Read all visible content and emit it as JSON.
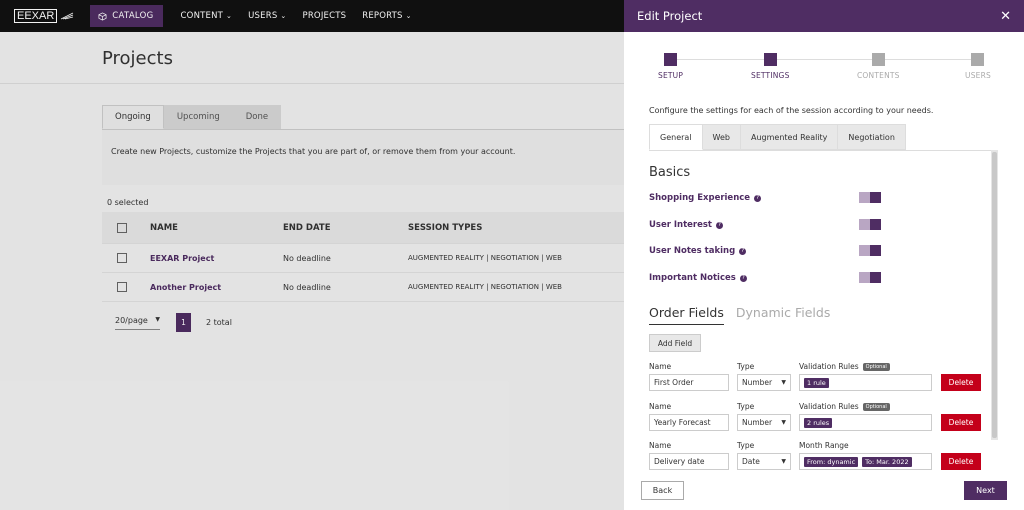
{
  "nav": {
    "logo": "EEXAR",
    "catalog": "CATALOG",
    "links": [
      {
        "label": "CONTENT",
        "dropdown": true
      },
      {
        "label": "USERS",
        "dropdown": true
      },
      {
        "label": "PROJECTS",
        "dropdown": false
      },
      {
        "label": "REPORTS",
        "dropdown": true
      }
    ]
  },
  "page": {
    "title": "Projects",
    "tabs": [
      "Ongoing",
      "Upcoming",
      "Done"
    ],
    "active_tab": "Ongoing",
    "description": "Create new Projects, customize the Projects that you are part of, or remove them from your account.",
    "selected_count": "0 selected",
    "table": {
      "headers": [
        "NAME",
        "END DATE",
        "SESSION TYPES"
      ],
      "rows": [
        {
          "name": "EEXAR Project",
          "end_date": "No deadline",
          "session_types": "AUGMENTED REALITY | NEGOTIATION | WEB"
        },
        {
          "name": "Another Project",
          "end_date": "No deadline",
          "session_types": "AUGMENTED REALITY | NEGOTIATION | WEB"
        }
      ]
    },
    "pager": {
      "per_page": "20/page",
      "current_page": "1",
      "total": "2 total"
    }
  },
  "drawer": {
    "title": "Edit Project",
    "steps": [
      {
        "label": "SETUP",
        "done": true
      },
      {
        "label": "SETTINGS",
        "done": true
      },
      {
        "label": "CONTENTS",
        "done": false
      },
      {
        "label": "USERS",
        "done": false
      }
    ],
    "config_text": "Configure the settings for each of the session according to your needs.",
    "tabs": [
      "General",
      "Web",
      "Augmented Reality",
      "Negotiation"
    ],
    "active_tab": "General",
    "basics_title": "Basics",
    "toggles": [
      {
        "label": "Shopping Experience",
        "on": true
      },
      {
        "label": "User Interest",
        "on": true
      },
      {
        "label": "User Notes taking",
        "on": true
      },
      {
        "label": "Important Notices",
        "on": true
      }
    ],
    "field_tabs": [
      "Order Fields",
      "Dynamic Fields"
    ],
    "active_field_tab": "Order Fields",
    "add_field": "Add Field",
    "labels": {
      "name": "Name",
      "type": "Type",
      "validation": "Validation Rules",
      "optional": "Optional",
      "month_range": "Month Range"
    },
    "fields": [
      {
        "name": "First Order",
        "type": "Number",
        "rule_chips": [
          "1 rule"
        ],
        "delete": "Delete"
      },
      {
        "name": "Yearly Forecast",
        "type": "Number",
        "rule_chips": [
          "2 rules"
        ],
        "delete": "Delete"
      },
      {
        "name": "Delivery date",
        "type": "Date",
        "range_chips": [
          "From: dynamic",
          "To: Mar. 2022"
        ],
        "delete": "Delete"
      }
    ],
    "back": "Back",
    "next": "Next"
  },
  "colors": {
    "brand": "#4f2d63",
    "danger": "#c4001a",
    "nav_bg": "#111111"
  }
}
